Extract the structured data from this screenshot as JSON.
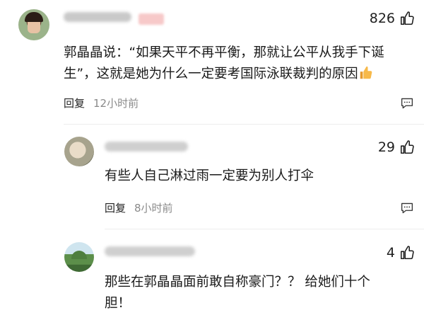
{
  "comments": [
    {
      "likes": "826",
      "text_line1": "郭晶晶说：“如果天平不再平衡，那就让公平从我手下诞",
      "text_line2": "生”，这就是她为什么一定要考国际泳联裁判的原因",
      "reply_label": "回复",
      "time": "12小时前"
    },
    {
      "likes": "29",
      "text_line1": "有些人自己淋过雨一定要为别人打伞",
      "reply_label": "回复",
      "time": "8小时前"
    },
    {
      "likes": "4",
      "text_line1": "那些在郭晶晶面前敢自称豪门？？ 给她们十个",
      "text_line2": "胆！"
    }
  ],
  "icons": {
    "like": "thumbs-up-outline",
    "reply": "chat-bubble",
    "emoji": "thumbs-up-emoji"
  },
  "colors": {
    "text": "#1a1a1a",
    "meta": "#8a8a8a",
    "emoji": "#f3b24a"
  }
}
